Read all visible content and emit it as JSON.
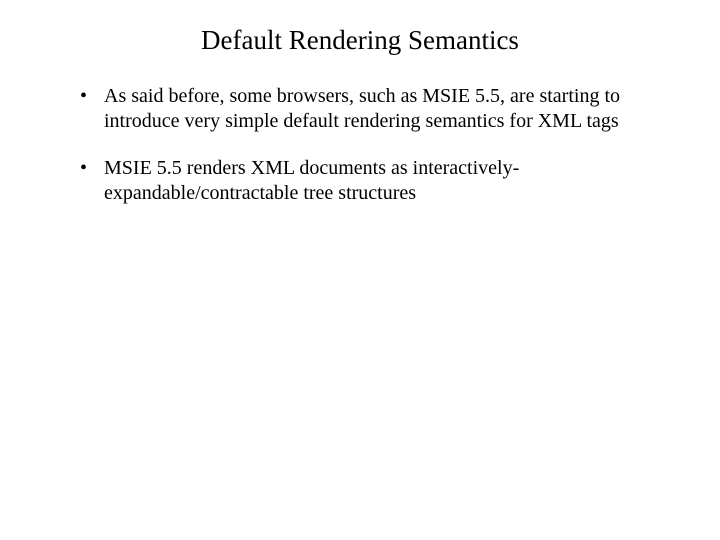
{
  "title": "Default Rendering Semantics",
  "bullets": [
    {
      "text": "As said before, some browsers, such as MSIE 5.5, are starting to introduce very simple default rendering semantics for XML tags"
    },
    {
      "text": "MSIE 5.5 renders XML documents as interactively-expandable/contractable tree structures"
    }
  ]
}
